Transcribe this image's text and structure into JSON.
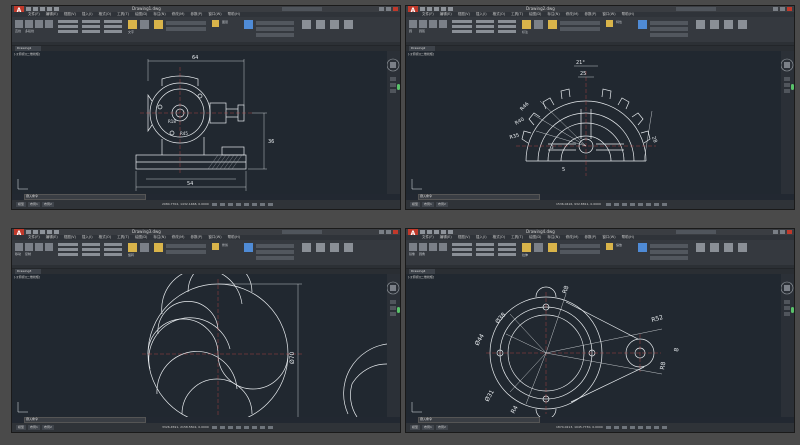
{
  "windows": [
    {
      "id": "w1",
      "app_icon": "A",
      "title": "Drawing1.dwg",
      "menus": [
        "文件(F)",
        "编辑(E)",
        "视图(V)",
        "插入(I)",
        "格式(O)",
        "工具(T)",
        "绘图(D)",
        "标注(N)",
        "修改(M)",
        "参数(P)",
        "窗口(W)",
        "帮助(H)"
      ],
      "doc_tab": "Drawing1",
      "viewport_label": "[-][俯视][二维线框]",
      "command_prompt": "键入命令",
      "model_tabs": [
        "模型",
        "布局1",
        "布局2"
      ],
      "coords": "2084.7702, 1432.1468, 0.0000",
      "dims": {
        "top": "64",
        "right": "36",
        "bottom": "54",
        "r1": "R18",
        "r2": "R45"
      }
    },
    {
      "id": "w2",
      "app_icon": "A",
      "title": "Drawing2.dwg",
      "menus": [
        "文件(F)",
        "编辑(E)",
        "视图(V)",
        "插入(I)",
        "格式(O)",
        "工具(T)",
        "绘图(D)",
        "标注(N)",
        "修改(M)",
        "参数(P)",
        "窗口(W)",
        "帮助(H)"
      ],
      "doc_tab": "Drawing2",
      "viewport_label": "[-][俯视][二维线框]",
      "command_prompt": "键入命令",
      "model_tabs": [
        "模型",
        "布局1",
        "布局2"
      ],
      "coords": "1536.0416, 932.8811, 0.0000",
      "dims": {
        "d21": "21°",
        "d25": "25",
        "r46": "R46",
        "r40": "R40",
        "r35": "R35",
        "d28": "28",
        "d5": "5",
        "d3": "3"
      }
    },
    {
      "id": "w3",
      "app_icon": "A",
      "title": "Drawing3.dwg",
      "menus": [
        "文件(F)",
        "编辑(E)",
        "视图(V)",
        "插入(I)",
        "格式(O)",
        "工具(T)",
        "绘图(D)",
        "标注(N)",
        "修改(M)",
        "参数(P)",
        "窗口(W)",
        "帮助(H)"
      ],
      "doc_tab": "Drawing3",
      "viewport_label": "[-][俯视][二维线框]",
      "command_prompt": "键入命令",
      "model_tabs": [
        "模型",
        "布局1",
        "布局2"
      ],
      "coords": "3326.4591, 2158.5502, 0.0000",
      "dims": {
        "dia": "Ø70"
      }
    },
    {
      "id": "w4",
      "app_icon": "A",
      "title": "Drawing4.dwg",
      "menus": [
        "文件(F)",
        "编辑(E)",
        "视图(V)",
        "插入(I)",
        "格式(O)",
        "工具(T)",
        "绘图(D)",
        "标注(N)",
        "修改(M)",
        "参数(P)",
        "窗口(W)",
        "帮助(H)"
      ],
      "doc_tab": "Drawing4",
      "viewport_label": "[-][俯视][二维线框]",
      "command_prompt": "键入命令",
      "model_tabs": [
        "模型",
        "布局1",
        "布局2"
      ],
      "coords": "1874.0213, 1045.7730, 0.0000",
      "dims": {
        "d38": "Ø38",
        "r8": "R8",
        "d44": "Ø44",
        "r52": "R52",
        "d31": "Ø31",
        "r4": "R4",
        "r8b": "8",
        "r8c": "R8"
      }
    }
  ],
  "ribbon": {
    "labels": [
      "直线",
      "多段线",
      "圆",
      "圆弧",
      "移动",
      "复制",
      "旋转",
      "修剪",
      "镜像",
      "圆角",
      "拉伸",
      "缩放",
      "阵列",
      "文字",
      "标注",
      "图层",
      "特性",
      "组",
      "实用工具",
      "剪贴板",
      "视图"
    ]
  },
  "colors": {
    "background": "#4a4a4a",
    "canvas": "#212830",
    "ribbon": "#35393f",
    "app_red": "#c0392b",
    "line": "#e8ecef",
    "center_line": "#c94848",
    "dimension": "#e8ecef"
  }
}
